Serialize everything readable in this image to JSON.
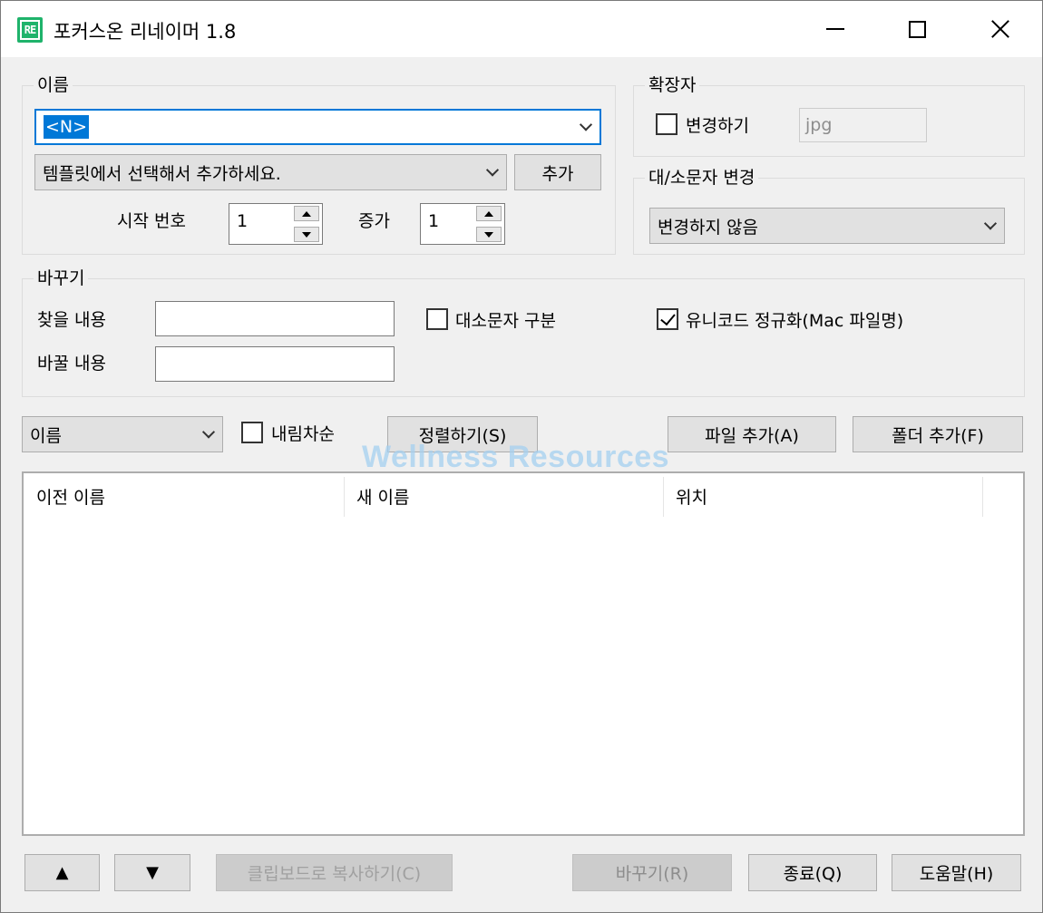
{
  "window": {
    "title": "포커스온 리네이머 1.8",
    "app_icon_text": "RE"
  },
  "name_group": {
    "legend": "이름",
    "pattern_value": "<N>",
    "template_placeholder": "템플릿에서 선택해서 추가하세요.",
    "add_label": "추가",
    "start_number_label": "시작 번호",
    "start_number_value": "1",
    "increment_label": "증가",
    "increment_value": "1"
  },
  "extension_group": {
    "legend": "확장자",
    "change_label": "변경하기",
    "change_checked": false,
    "extension_value": "jpg"
  },
  "case_group": {
    "legend": "대/소문자 변경",
    "selected": "변경하지 않음"
  },
  "replace_group": {
    "legend": "바꾸기",
    "find_label": "찾을 내용",
    "find_value": "",
    "replace_label": "바꿀 내용",
    "replace_value": "",
    "case_sensitive_label": "대소문자 구분",
    "case_sensitive_checked": false,
    "unicode_label": "유니코드 정규화(Mac 파일명)",
    "unicode_checked": true
  },
  "sort_bar": {
    "sort_by": "이름",
    "descending_label": "내림차순",
    "descending_checked": false,
    "sort_button": "정렬하기(S)",
    "add_files_button": "파일 추가(A)",
    "add_folder_button": "폴더 추가(F)"
  },
  "watermark": "Wellness Resources",
  "file_list": {
    "columns": [
      "이전 이름",
      "새 이름",
      "위치"
    ],
    "rows": []
  },
  "bottom_bar": {
    "move_up": "▲",
    "move_down": "▼",
    "copy_clipboard": "클립보드로 복사하기(C)",
    "rename": "바꾸기(R)",
    "exit": "종료(Q)",
    "help": "도움말(H)"
  }
}
